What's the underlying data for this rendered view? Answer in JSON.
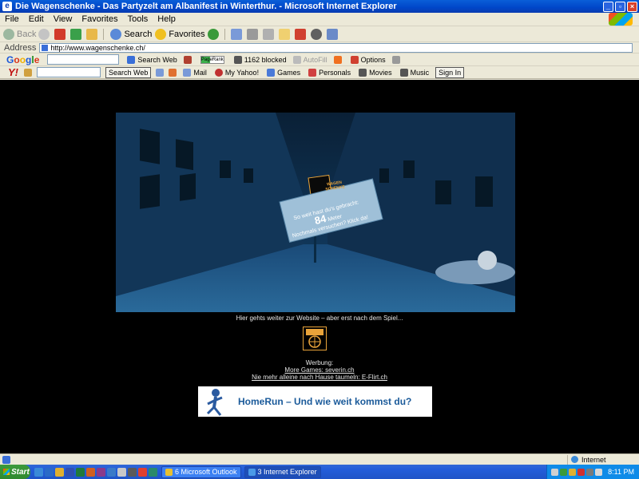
{
  "window": {
    "title": "Die Wagenschenke - Das Partyzelt am Albanifest in Winterthur. - Microsoft Internet Explorer",
    "min": "_",
    "max": "▫",
    "close": "×"
  },
  "menu": [
    "File",
    "Edit",
    "View",
    "Favorites",
    "Tools",
    "Help"
  ],
  "toolbar": {
    "back": "Back",
    "search": "Search",
    "favorites": "Favorites"
  },
  "address": {
    "label": "Address",
    "url": "http://www.wagenschenke.ch/"
  },
  "google": {
    "logo": [
      "G",
      "o",
      "o",
      "g",
      "l",
      "e"
    ],
    "search_web": "Search Web",
    "pagerank": "PageRank",
    "blocked": "1162 blocked",
    "autofill": "AutoFill",
    "options": "Options"
  },
  "yahoo": {
    "logo": "Y!",
    "search_web": "Search Web",
    "mail": "Mail",
    "my_yahoo": "My Yahoo!",
    "games": "Games",
    "personals": "Personals",
    "movies": "Movies",
    "music": "Music",
    "sign_in": "Sign In"
  },
  "game": {
    "logo_line1": "WAGEN",
    "logo_line2": "SCHENKE",
    "sign_line1": "So weit hast du's gebracht:",
    "distance": "84",
    "unit": "Meter",
    "sign_line3": "Nochmals versuchen? Klick da!"
  },
  "page": {
    "continue_text": "Hier gehts weiter zur Website – aber erst nach dem Spiel...",
    "ads_heading": "Werbung:",
    "ad_link1": "More Games: severin.ch",
    "ad_link2": "Nie mehr alleine nach Hause taumeln: E-Flirt.ch",
    "banner_text": "HomeRun – Und wie weit kommst du?"
  },
  "status": {
    "zone": "Internet"
  },
  "taskbar": {
    "start": "Start",
    "outlook": "6 Microsoft Outlook",
    "ie": "3 Internet Explorer",
    "clock": "8:11 PM"
  }
}
